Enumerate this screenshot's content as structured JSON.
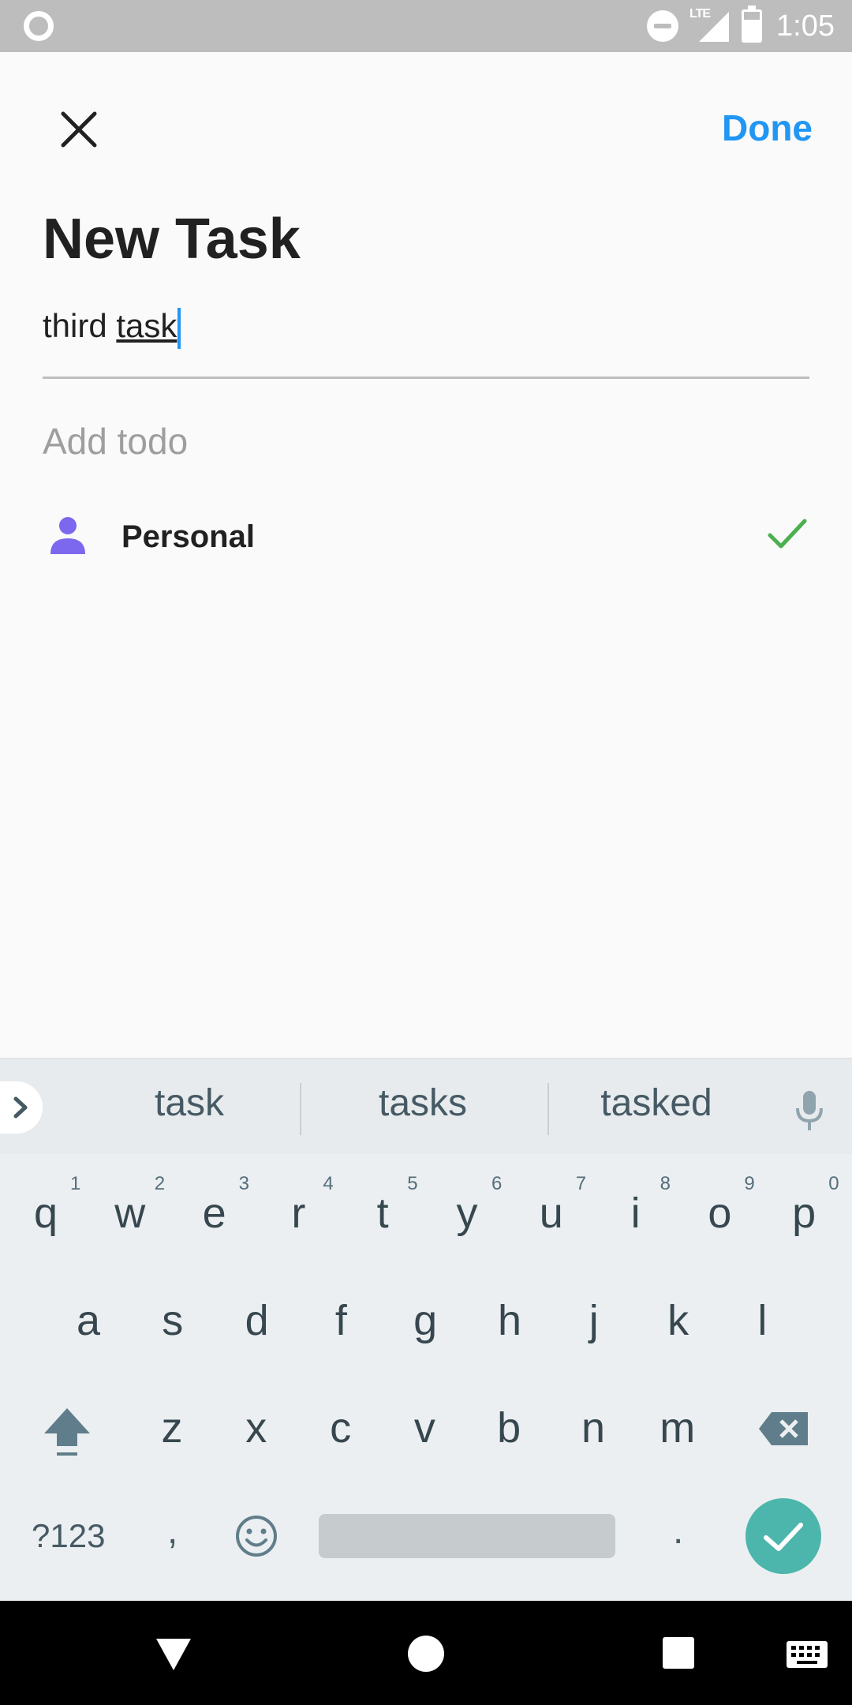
{
  "status_bar": {
    "time": "1:05",
    "network": "LTE",
    "icons": [
      "circle-notification-icon",
      "do-not-disturb-icon",
      "lte-signal-icon",
      "battery-icon"
    ]
  },
  "header": {
    "close_icon": "close-icon",
    "done_label": "Done",
    "title": "New Task"
  },
  "task_input": {
    "value_plain": "third ",
    "value_composing": "task"
  },
  "add_todo": {
    "placeholder": "Add todo"
  },
  "list": {
    "icon": "person-icon",
    "label": "Personal",
    "selected_icon": "check-icon"
  },
  "keyboard": {
    "suggestions": [
      "task",
      "tasks",
      "tasked"
    ],
    "row1": [
      {
        "k": "q",
        "n": "1"
      },
      {
        "k": "w",
        "n": "2"
      },
      {
        "k": "e",
        "n": "3"
      },
      {
        "k": "r",
        "n": "4"
      },
      {
        "k": "t",
        "n": "5"
      },
      {
        "k": "y",
        "n": "6"
      },
      {
        "k": "u",
        "n": "7"
      },
      {
        "k": "i",
        "n": "8"
      },
      {
        "k": "o",
        "n": "9"
      },
      {
        "k": "p",
        "n": "0"
      }
    ],
    "row2": [
      "a",
      "s",
      "d",
      "f",
      "g",
      "h",
      "j",
      "k",
      "l"
    ],
    "row3": [
      "z",
      "x",
      "c",
      "v",
      "b",
      "n",
      "m"
    ],
    "symbols_label": "?123",
    "comma": ",",
    "period": "."
  },
  "colors": {
    "accent": "#2196f3",
    "check": "#4caf50",
    "person": "#7b68ee",
    "enter": "#4db6ac"
  }
}
